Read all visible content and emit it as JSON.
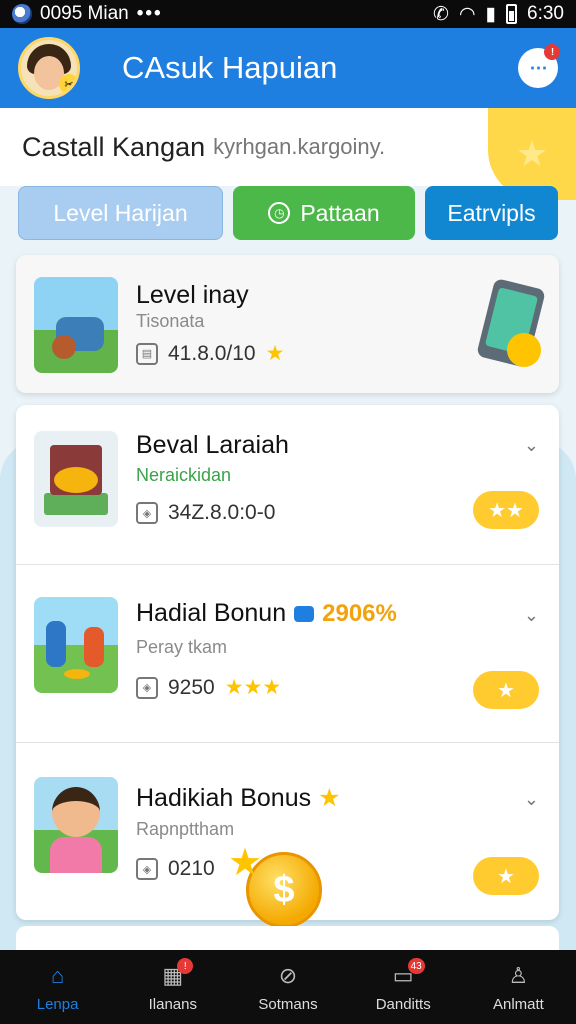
{
  "status_bar": {
    "time_left": "0095 Mian",
    "dots": "•••",
    "time_right": "6:30"
  },
  "header": {
    "title": "CAsuk Hapuian",
    "menu_badge": "!"
  },
  "subtitle": {
    "main": "Castall Kangan",
    "hint": "kyrhgan.kargoiny."
  },
  "tabs": [
    {
      "label": "Level Harijan"
    },
    {
      "label": "Pattaan"
    },
    {
      "label": "Eatrvipls"
    }
  ],
  "featured": {
    "title": "Level inay",
    "subtitle": "Tisonata",
    "meta": "41.8.0/10",
    "star": "★"
  },
  "items": [
    {
      "title": "Beval Laraiah",
      "subtitle": "Neraickidan",
      "meta": "34Z.8.0:0-0",
      "pill": "★★",
      "chevron": "⌄"
    },
    {
      "title": "Hadial Bonun",
      "bonus": "2906%",
      "subtitle": "Peray tkam",
      "meta": "9250",
      "stars": "★★★",
      "pill": "★",
      "chevron": "⌄"
    },
    {
      "title": "Hadikiah Bonus",
      "title_star": "★",
      "subtitle": "Rapnpttham",
      "meta": "0210",
      "pill": "★",
      "chevron": "⌄"
    }
  ],
  "coin": {
    "symbol": "$"
  },
  "bottom_nav": [
    {
      "label": "Lenpa",
      "icon": "home-icon",
      "active": true
    },
    {
      "label": "Ilanans",
      "icon": "inbox-icon",
      "badge": "!"
    },
    {
      "label": "Sotmans",
      "icon": "compass-icon"
    },
    {
      "label": "Danditts",
      "icon": "message-icon",
      "badge": "43"
    },
    {
      "label": "Anlmatt",
      "icon": "profile-icon"
    }
  ],
  "colors": {
    "primary": "#1f7fe0",
    "green": "#4db84a",
    "accent": "#ffcb2e",
    "nav_bg": "#0e0e0e"
  }
}
